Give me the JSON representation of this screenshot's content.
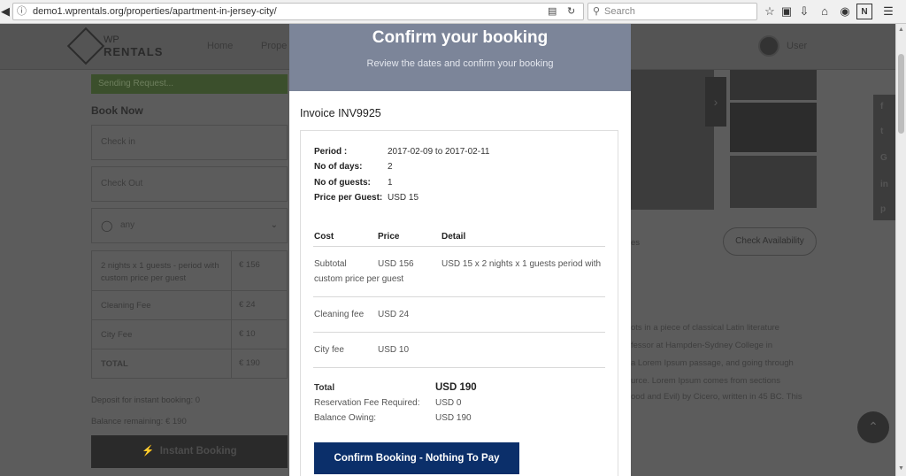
{
  "browser": {
    "url": "demo1.wprentals.org/properties/apartment-in-jersey-city/",
    "search_placeholder": "Search",
    "icons": [
      "back-icon",
      "info-icon",
      "reader-icon",
      "reload-icon",
      "search-icon",
      "star-icon",
      "clipboard-icon",
      "download-icon",
      "home-icon",
      "pocket-icon",
      "extension-icon",
      "menu-icon"
    ]
  },
  "site": {
    "logo_line1": "WP",
    "logo_line2": "RENTALS",
    "nav": [
      "Home",
      "Prope"
    ],
    "user_label": "User",
    "sending": "Sending Request...",
    "book_now": "Book Now",
    "check_in": "Check in",
    "check_out": "Check Out",
    "guests": "any",
    "price_rows": [
      {
        "label": "2 nights x 1 guests - period with custom price per guest",
        "value": "€ 156"
      },
      {
        "label": "Cleaning Fee",
        "value": "€ 24"
      },
      {
        "label": "City Fee",
        "value": "€ 10"
      },
      {
        "label": "TOTAL",
        "value": "€ 190"
      }
    ],
    "deposit": "Deposit for instant booking: 0",
    "balance": "Balance remaining: € 190",
    "instant_booking": "Instant Booking",
    "check_availability": "Check Availability",
    "overview_fragment": "es",
    "lorem_lines": [
      "ots in a piece of classical Latin literature",
      "fessor at Hampden-Sydney College in",
      "a Lorem Ipsum passage, and going through",
      "urce. Lorem Ipsum comes from sections",
      "ood and Evil) by Cicero, written in 45 BC. This"
    ],
    "social": [
      "f",
      "t",
      "G",
      "in",
      "p"
    ]
  },
  "modal": {
    "title": "Confirm your booking",
    "subtitle": "Review the dates and confirm your booking",
    "invoice": "Invoice INV9925",
    "details": [
      {
        "label": "Period :",
        "value": "2017-02-09 to 2017-02-11"
      },
      {
        "label": "No of days:",
        "value": "2"
      },
      {
        "label": "No of guests:",
        "value": "1"
      },
      {
        "label": "Price per Guest:",
        "value": "USD 15"
      }
    ],
    "columns": [
      "Cost",
      "Price",
      "Detail"
    ],
    "rows": [
      {
        "cost": "Subtotal",
        "price": "USD 156",
        "detail": "USD 15 x 2 nights x 1 guests period with",
        "cont": "custom price per guest"
      },
      {
        "cost": "Cleaning fee",
        "price": "USD 24",
        "detail": ""
      },
      {
        "cost": "City fee",
        "price": "USD 10",
        "detail": ""
      }
    ],
    "total_label": "Total",
    "total_value": "USD 190",
    "reservation_label": "Reservation Fee Required:",
    "reservation_value": "USD 0",
    "balance_label": "Balance Owing:",
    "balance_value": "USD 190",
    "confirm_button": "Confirm Booking - Nothing To Pay"
  }
}
